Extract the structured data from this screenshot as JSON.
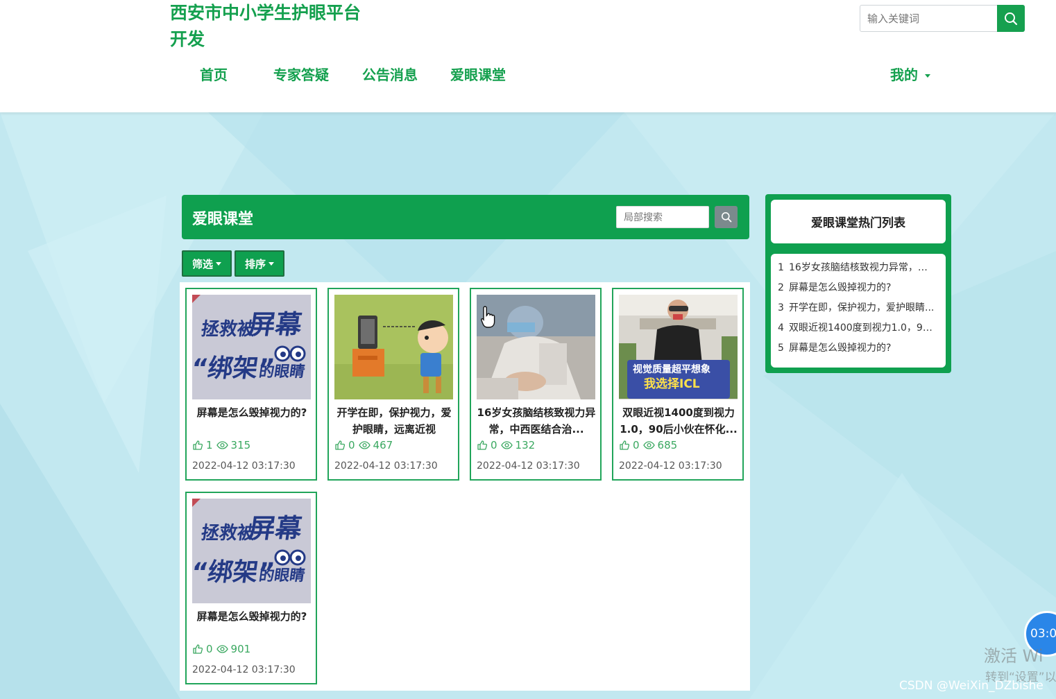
{
  "header": {
    "site_title_line1": "西安市中小学生护眼平台",
    "site_title_line2": "开发",
    "search_placeholder": "输入关键词",
    "nav": [
      "首页",
      "专家答疑",
      "公告消息",
      "爱眼课堂"
    ],
    "mine": "我的"
  },
  "section": {
    "title": "爱眼课堂",
    "local_search_placeholder": "局部搜索",
    "filter_label": "筛选",
    "sort_label": "排序"
  },
  "cards": [
    {
      "title": "屏幕是怎么毁掉视力的?",
      "likes": "1",
      "views": "315",
      "date": "2022-04-12 03:17:30",
      "image": "screen-poster"
    },
    {
      "title": "开学在即，保护视力，爱护眼睛，远离近视",
      "likes": "0",
      "views": "467",
      "date": "2022-04-12 03:17:30",
      "image": "tv-cartoon"
    },
    {
      "title": "16岁女孩脑结核致视力异常，中西医结合治...",
      "likes": "0",
      "views": "132",
      "date": "2022-04-12 03:17:30",
      "image": "hospital-photo"
    },
    {
      "title": "双眼近视1400度到视力1.0，90后小伙在怀化...",
      "likes": "0",
      "views": "685",
      "date": "2022-04-12 03:17:30",
      "image": "icl-photo"
    },
    {
      "title": "屏幕是怎么毁掉视力的?",
      "likes": "0",
      "views": "901",
      "date": "2022-04-12 03:17:30",
      "image": "screen-poster"
    }
  ],
  "poster_text": {
    "line1a": "拯救被",
    "line1b": "屏幕",
    "line2a": "“绑架”",
    "line2b": "的眼睛"
  },
  "icl_photo_text": {
    "line1": "视觉质量超平想象",
    "line2": "我选择ICL"
  },
  "hot": {
    "title": "爱眼课堂热门列表",
    "items": [
      "16岁女孩脑结核致视力异常，中...",
      "屏幕是怎么毁掉视力的?",
      "开学在即，保护视力，爱护眼睛...",
      "双眼近视1400度到视力1.0，90...",
      "屏幕是怎么毁掉视力的?"
    ]
  },
  "overlays": {
    "timer": "03:0",
    "watermark_line1": "激活 Wi",
    "watermark_line2": "转到“设置”以",
    "csdn": "CSDN @WeiXin_DZbishe"
  },
  "colors": {
    "brand_green": "#0fa04f",
    "nav_green": "#14a04e",
    "stat_green": "#3aa860",
    "background": "#bfe6ef"
  },
  "icons": [
    "search-icon",
    "caret-down-icon",
    "like-icon",
    "eye-icon",
    "hand-cursor-icon"
  ]
}
